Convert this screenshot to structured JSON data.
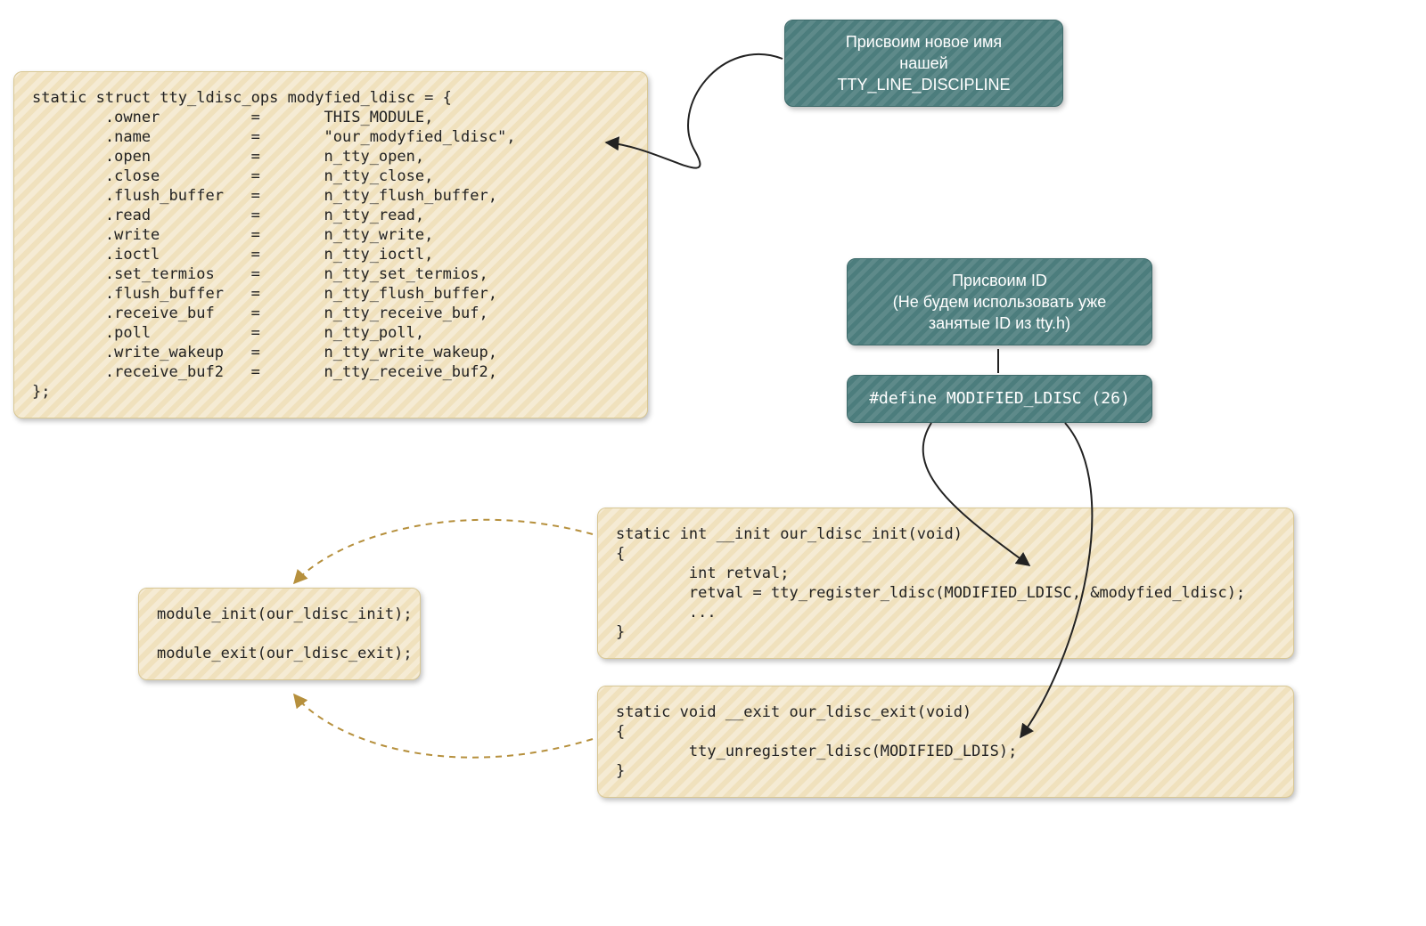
{
  "top_note": {
    "line1": "Присвоим новое имя",
    "line2": "нашей",
    "line3": "TTY_LINE_DISCIPLINE"
  },
  "id_note": {
    "line1": "Присвоим ID",
    "line2": "(Не будем использовать уже",
    "line3": "занятые ID из tty.h)"
  },
  "define_note": "#define MODIFIED_LDISC  (26)",
  "struct_code": "static struct tty_ldisc_ops modyfied_ldisc = {\n        .owner          =       THIS_MODULE,\n        .name           =       \"our_modyfied_ldisc\",\n        .open           =       n_tty_open,\n        .close          =       n_tty_close,\n        .flush_buffer   =       n_tty_flush_buffer,\n        .read           =       n_tty_read,\n        .write          =       n_tty_write,\n        .ioctl          =       n_tty_ioctl,\n        .set_termios    =       n_tty_set_termios,\n        .flush_buffer   =       n_tty_flush_buffer,\n        .receive_buf    =       n_tty_receive_buf,\n        .poll           =       n_tty_poll,\n        .write_wakeup   =       n_tty_write_wakeup,\n        .receive_buf2   =       n_tty_receive_buf2,\n};",
  "init_code": "static int __init our_ldisc_init(void)\n{\n        int retval;\n        retval = tty_register_ldisc(MODIFIED_LDISC, &modyfied_ldisc);\n        ...\n}",
  "exit_code": "static void __exit our_ldisc_exit(void)\n{\n        tty_unregister_ldisc(MODIFIED_LDIS);\n}",
  "module_code": "module_init(our_ldisc_init);\n\nmodule_exit(our_ldisc_exit);"
}
